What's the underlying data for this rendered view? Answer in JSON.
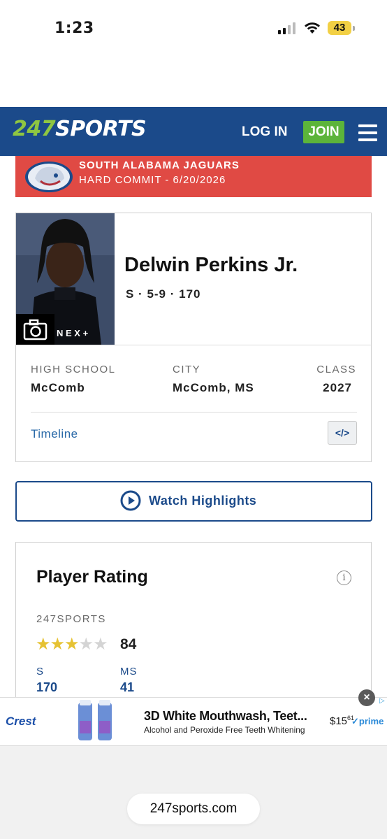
{
  "status_bar": {
    "time": "1:23",
    "battery": "43"
  },
  "nav": {
    "logo_num": "247",
    "logo_text": "SPORTS",
    "login": "LOG IN",
    "join": "JOIN"
  },
  "commit": {
    "team": "SOUTH ALABAMA JAGUARS",
    "status": "HARD COMMIT - 6/20/2026"
  },
  "player": {
    "name": "Delwin Perkins Jr.",
    "meta": "S · 5-9 · 170",
    "high_school_label": "HIGH SCHOOL",
    "high_school": "McComb",
    "city_label": "CITY",
    "city": "McComb, MS",
    "class_label": "CLASS",
    "class": "2027",
    "timeline": "Timeline",
    "embed": "</>"
  },
  "watch": {
    "label": "Watch Highlights"
  },
  "rating": {
    "title": "Player Rating",
    "info": "i",
    "source": "247SPORTS",
    "stars_filled": 3,
    "stars_total": 5,
    "score": "84",
    "position_label": "S",
    "position_rank": "170",
    "state_label": "MS",
    "state_rank": "41"
  },
  "ad": {
    "brand": "Crest",
    "headline": "3D White Mouthwash, Teet...",
    "subline": "Alcohol and Peroxide Free Teeth Whitening",
    "price_dollars": "$15",
    "price_cents": "61",
    "prime": "prime",
    "close": "×",
    "choice": "▷"
  },
  "url": "247sports.com",
  "colors": {
    "navy": "#1b4a8a",
    "green": "#5cb43a",
    "red": "#e04a44",
    "star": "#e6c233"
  }
}
